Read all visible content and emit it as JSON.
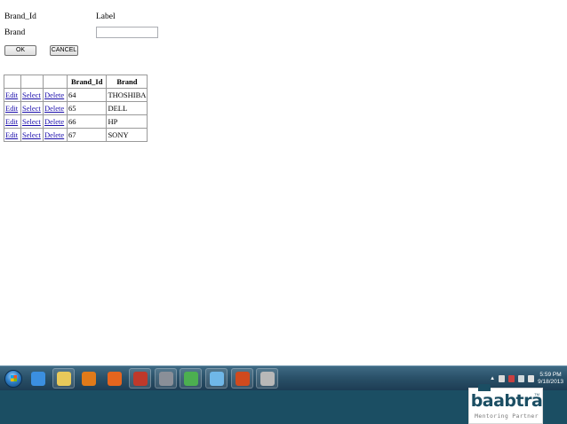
{
  "form": {
    "brand_id_label": "Brand_Id",
    "label_text": "Label",
    "brand_label": "Brand",
    "brand_input_value": "",
    "ok_label": "OK",
    "cancel_label": "CANCEL"
  },
  "grid": {
    "headers": [
      "",
      "",
      "",
      "Brand_Id",
      "Brand"
    ],
    "rows": [
      {
        "edit": "Edit",
        "select": "Select",
        "delete": "Delete",
        "id": "64",
        "brand": "THOSHIBA"
      },
      {
        "edit": "Edit",
        "select": "Select",
        "delete": "Delete",
        "id": "65",
        "brand": "DELL"
      },
      {
        "edit": "Edit",
        "select": "Select",
        "delete": "Delete",
        "id": "66",
        "brand": "HP"
      },
      {
        "edit": "Edit",
        "select": "Select",
        "delete": "Delete",
        "id": "67",
        "brand": "SONY"
      }
    ]
  },
  "taskbar": {
    "apps": [
      {
        "name": "internet-explorer-icon",
        "color": "#3b8fe0",
        "boxed": false
      },
      {
        "name": "file-explorer-icon",
        "color": "#e8c95a",
        "boxed": true
      },
      {
        "name": "media-player-icon",
        "color": "#e07a1a",
        "boxed": false
      },
      {
        "name": "firefox-icon",
        "color": "#e5651e",
        "boxed": false
      },
      {
        "name": "paint-icon",
        "color": "#c0392b",
        "boxed": true
      },
      {
        "name": "tools-icon",
        "color": "#8a8f98",
        "boxed": true
      },
      {
        "name": "chrome-icon",
        "color": "#4caf50",
        "boxed": true
      },
      {
        "name": "notepad-icon",
        "color": "#6fb7e8",
        "boxed": true
      },
      {
        "name": "powerpoint-icon",
        "color": "#d04a1e",
        "boxed": true
      },
      {
        "name": "chess-icon",
        "color": "#b8b8b8",
        "boxed": true
      }
    ],
    "clock_time": "5:59 PM",
    "clock_date": "9/18/2013",
    "tray_arrow": "▲"
  },
  "branding": {
    "logo_text": "baabtra",
    "logo_tm": "TM",
    "tagline": "Mentoring Partner",
    "band_color": "#1b4e63"
  }
}
